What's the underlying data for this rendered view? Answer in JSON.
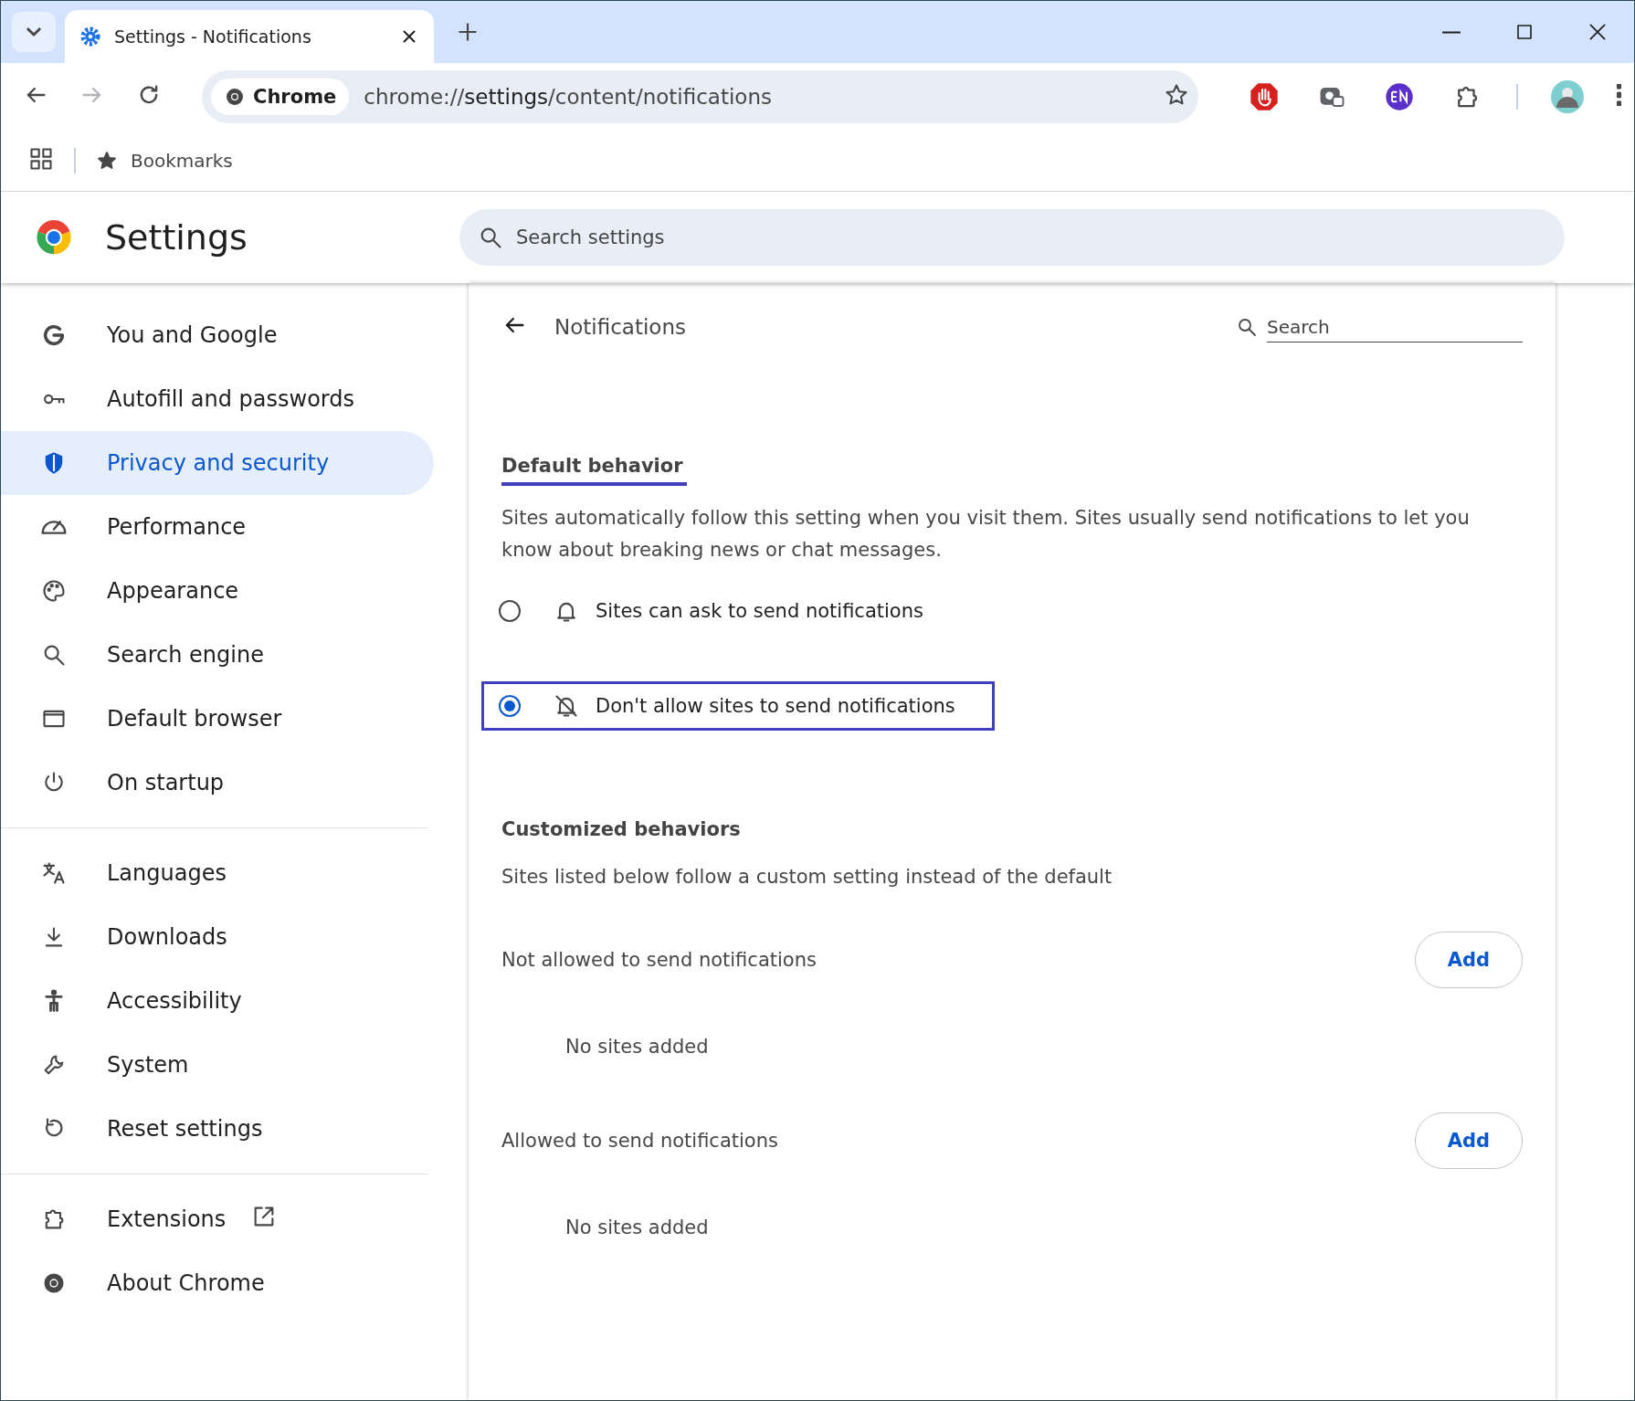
{
  "tabs": [
    {
      "title": "Settings - Notifications",
      "selected": true
    }
  ],
  "address": {
    "chip": "Chrome",
    "scheme": "chrome://",
    "host": "settings",
    "path": "/content/notifications"
  },
  "bookmarks_bar": {
    "label": "Bookmarks"
  },
  "header": {
    "title": "Settings",
    "search_placeholder": "Search settings"
  },
  "sidebar": {
    "groups": [
      {
        "items": [
          {
            "label": "You and Google",
            "selected": false,
            "external": false
          },
          {
            "label": "Autofill and passwords",
            "selected": false,
            "external": false
          },
          {
            "label": "Privacy and security",
            "selected": true,
            "external": false
          },
          {
            "label": "Performance",
            "selected": false,
            "external": false
          },
          {
            "label": "Appearance",
            "selected": false,
            "external": false
          },
          {
            "label": "Search engine",
            "selected": false,
            "external": false
          },
          {
            "label": "Default browser",
            "selected": false,
            "external": false
          },
          {
            "label": "On startup",
            "selected": false,
            "external": false
          }
        ]
      },
      {
        "items": [
          {
            "label": "Languages",
            "selected": false,
            "external": false
          },
          {
            "label": "Downloads",
            "selected": false,
            "external": false
          },
          {
            "label": "Accessibility",
            "selected": false,
            "external": false
          },
          {
            "label": "System",
            "selected": false,
            "external": false
          },
          {
            "label": "Reset settings",
            "selected": false,
            "external": false
          }
        ]
      },
      {
        "items": [
          {
            "label": "Extensions",
            "selected": false,
            "external": true
          },
          {
            "label": "About Chrome",
            "selected": false,
            "external": false
          }
        ]
      }
    ]
  },
  "page": {
    "title": "Notifications",
    "search_placeholder": "Search",
    "default_heading": "Default behavior",
    "default_description": "Sites automatically follow this setting when you visit them. Sites usually send notifications to let you know about breaking news or chat messages.",
    "options": [
      {
        "label": "Sites can ask to send notifications",
        "selected": false,
        "focused": false
      },
      {
        "label": "Don't allow sites to send notifications",
        "selected": true,
        "focused": true
      }
    ],
    "custom_heading": "Customized behaviors",
    "custom_description": "Sites listed below follow a custom setting instead of the default",
    "lists": [
      {
        "title": "Not allowed to send notifications",
        "button": "Add",
        "empty": "No sites added"
      },
      {
        "title": "Allowed to send notifications",
        "button": "Add",
        "empty": "No sites added"
      }
    ]
  }
}
